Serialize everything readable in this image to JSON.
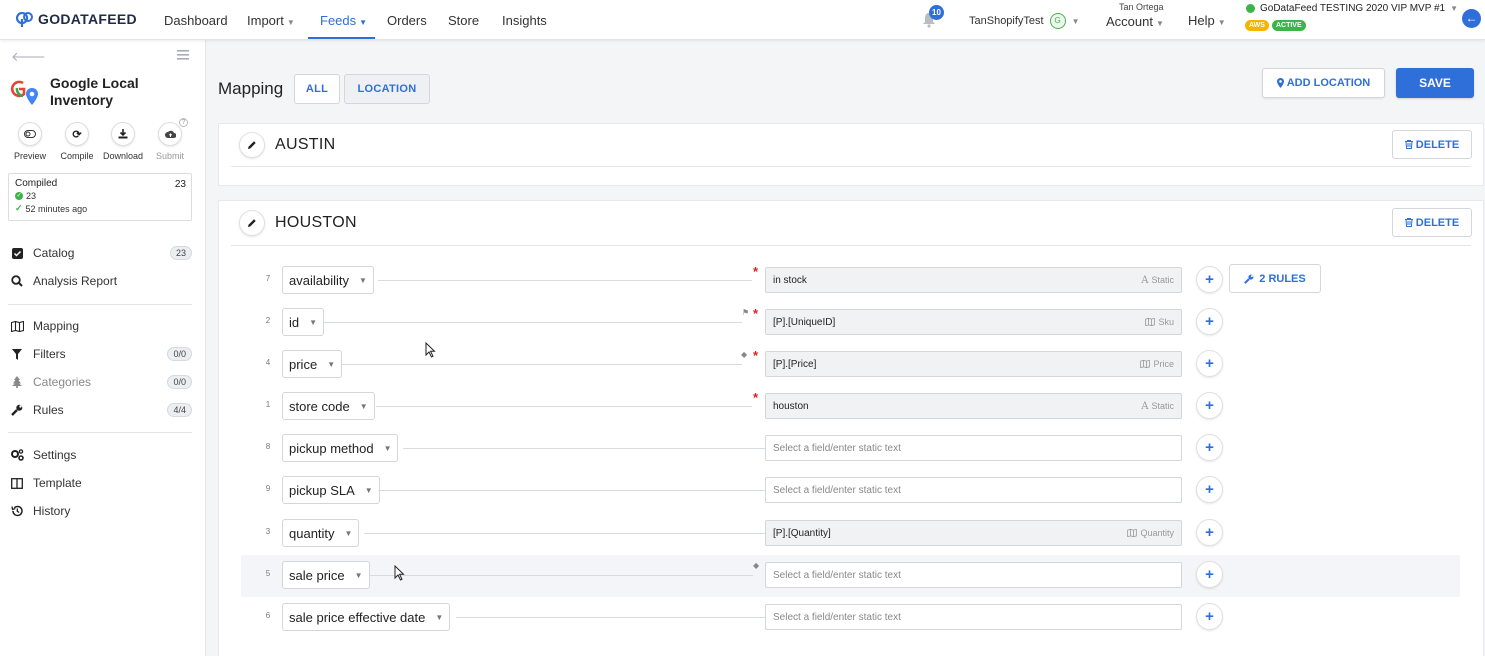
{
  "app": {
    "logo_text": "GODATAFEED"
  },
  "nav": {
    "items": [
      {
        "label": "Dashboard",
        "dropdown": false,
        "active": false
      },
      {
        "label": "Import",
        "dropdown": true,
        "active": false
      },
      {
        "label": "Feeds",
        "dropdown": true,
        "active": true
      },
      {
        "label": "Orders",
        "dropdown": false,
        "active": false
      },
      {
        "label": "Store",
        "dropdown": false,
        "active": false
      },
      {
        "label": "Insights",
        "dropdown": false,
        "active": false
      }
    ],
    "notifications_count": "10",
    "shop_name": "TanShopifyTest",
    "shop_badge": "G",
    "user_name": "Tan Ortega",
    "account_label": "Account",
    "help_label": "Help",
    "account_title": "GoDataFeed TESTING 2020 VIP MVP #1",
    "badge_aws": "AWS",
    "badge_active": "ACTIVE"
  },
  "sidebar": {
    "feed_title": "Google Local Inventory",
    "tools": [
      {
        "label": "Preview",
        "icon": "toggle-icon"
      },
      {
        "label": "Compile",
        "icon": "refresh-icon"
      },
      {
        "label": "Download",
        "icon": "download-icon"
      },
      {
        "label": "Submit",
        "icon": "cloud-upload-icon"
      }
    ],
    "compiled": {
      "label": "Compiled",
      "count": "23",
      "ok_count": "23",
      "time_ago": "52 minutes ago"
    },
    "items": [
      {
        "label": "Catalog",
        "count": "23",
        "icon": "checkbox-icon"
      },
      {
        "label": "Analysis Report",
        "count": "",
        "icon": "search-icon"
      },
      {
        "label": "Mapping",
        "count": "",
        "icon": "map-icon"
      },
      {
        "label": "Filters",
        "count": "0/0",
        "icon": "filter-icon"
      },
      {
        "label": "Categories",
        "count": "0/0",
        "icon": "tree-icon"
      },
      {
        "label": "Rules",
        "count": "4/4",
        "icon": "wrench-icon"
      },
      {
        "label": "Settings",
        "count": "",
        "icon": "gears-icon"
      },
      {
        "label": "Template",
        "count": "",
        "icon": "columns-icon"
      },
      {
        "label": "History",
        "count": "",
        "icon": "history-icon"
      }
    ]
  },
  "main": {
    "title": "Mapping",
    "tab_all": "ALL",
    "tab_location": "LOCATION",
    "add_location": "ADD LOCATION",
    "save": "SAVE",
    "delete": "DELETE",
    "locations": [
      "AUSTIN",
      "HOUSTON"
    ],
    "rows": [
      {
        "num": "7",
        "field": "availability",
        "required": true,
        "marker": "",
        "value": "in stock",
        "source": "Static",
        "filled": true,
        "rules": "2 RULES"
      },
      {
        "num": "2",
        "field": "id",
        "required": true,
        "marker": "flag-icon",
        "value": "[P].[UniqueID]",
        "source": "Sku",
        "filled": true,
        "rules": ""
      },
      {
        "num": "4",
        "field": "price",
        "required": true,
        "marker": "tag-icon",
        "value": "[P].[Price]",
        "source": "Price",
        "filled": true,
        "rules": ""
      },
      {
        "num": "1",
        "field": "store code",
        "required": true,
        "marker": "",
        "value": "houston",
        "source": "Static",
        "filled": true,
        "rules": ""
      },
      {
        "num": "8",
        "field": "pickup method",
        "required": false,
        "marker": "",
        "value": "Select a field/enter static text",
        "source": "",
        "filled": false,
        "rules": ""
      },
      {
        "num": "9",
        "field": "pickup SLA",
        "required": false,
        "marker": "",
        "value": "Select a field/enter static text",
        "source": "",
        "filled": false,
        "rules": ""
      },
      {
        "num": "3",
        "field": "quantity",
        "required": false,
        "marker": "",
        "value": "[P].[Quantity]",
        "source": "Quantity",
        "filled": true,
        "rules": ""
      },
      {
        "num": "5",
        "field": "sale price",
        "required": false,
        "marker": "tag-icon",
        "value": "Select a field/enter static text",
        "source": "",
        "filled": false,
        "rules": ""
      },
      {
        "num": "6",
        "field": "sale price effective date",
        "required": false,
        "marker": "",
        "value": "Select a field/enter static text",
        "source": "",
        "filled": false,
        "rules": ""
      }
    ]
  },
  "colors": {
    "accent": "#2f6fd9",
    "success": "#3bb54a",
    "required": "#e02020",
    "warning": "#f4b400"
  }
}
